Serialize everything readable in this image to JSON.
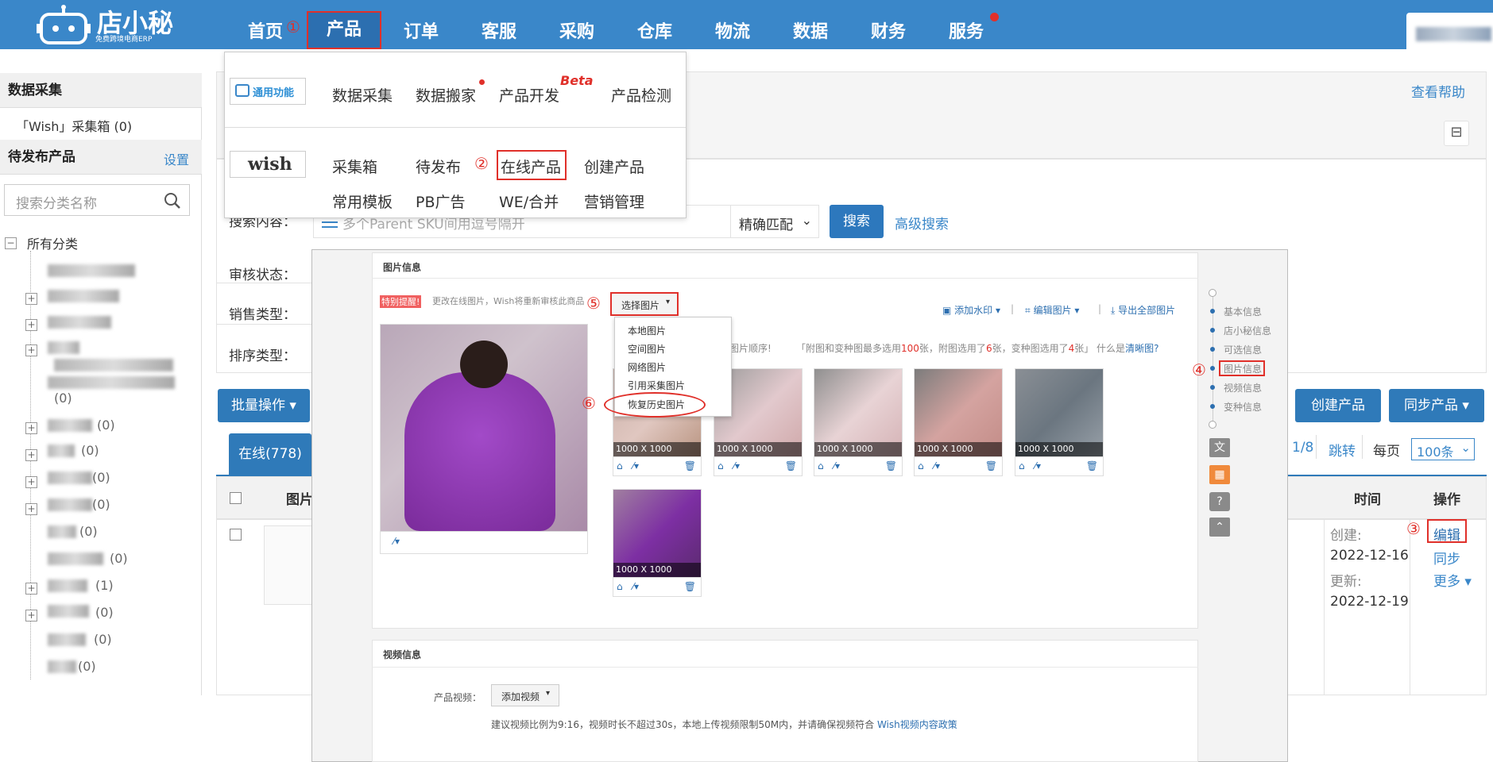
{
  "nav": {
    "logo_text": "店小秘",
    "logo_sub": "免费跨境电商ERP",
    "items": [
      "首页",
      "产品",
      "订单",
      "客服",
      "采购",
      "仓库",
      "物流",
      "数据",
      "财务",
      "服务"
    ],
    "steps": [
      "①",
      "②",
      "③",
      "④",
      "⑤",
      "⑥"
    ]
  },
  "sidebar": {
    "collect_title": "数据采集",
    "collect_box": "「Wish」采集箱 (0)",
    "pending_title": "待发布产品",
    "settings": "设置",
    "search_placeholder": "搜索分类名称",
    "all_categories": "所有分类",
    "counts": [
      "(0)",
      "(0)",
      "(0)",
      "(0)",
      "(0)",
      "(0)",
      "(0)",
      "(1)",
      "(0)",
      "(0)",
      "(0)"
    ]
  },
  "product_menu": {
    "general_tag": "通用功能",
    "wish_tag": "wish",
    "row1": [
      "数据采集",
      "数据搬家",
      "产品开发",
      "产品检测"
    ],
    "beta": "Beta",
    "row2": [
      "采集箱",
      "待发布",
      "在线产品",
      "创建产品"
    ],
    "row3": [
      "常用模板",
      "PB广告",
      "WE/合并",
      "营销管理"
    ]
  },
  "main": {
    "help": "查看帮助",
    "search_label": "搜索内容：",
    "search_placeholder": "多个Parent SKU间用逗号隔开",
    "match_select": "精确匹配",
    "search_btn": "搜索",
    "advanced_search": "高级搜索",
    "audit_status": "审核状态：",
    "sales_type": "销售类型：",
    "sort_type": "排序类型：",
    "bulk_ops": "批量操作",
    "create_product": "创建产品",
    "sync_product": "同步产品",
    "tab_online": "在线(778)",
    "pager": "1/8",
    "jump": "跳转",
    "per_page": "每页",
    "per_page_select": "100条",
    "col_image": "图片",
    "col_time": "时间",
    "col_ops": "操作",
    "created_label": "创建:",
    "created_date": "2022-12-16",
    "updated_label": "更新:",
    "updated_date": "2022-12-19",
    "op_edit": "编辑",
    "op_sync": "同步",
    "op_more": "更多"
  },
  "overlay": {
    "image_section": "图片信息",
    "notice_tag": "特别提醒!",
    "notice_text": "更改在线图片，Wish将重新审核此商品",
    "select_image": "选择图片",
    "add_watermark": "添加水印",
    "edit_image": "编辑图片",
    "export_all": "导出全部图片",
    "hint_text": "图片顺序!",
    "hint_text2": "「附图和变种图最多选用",
    "hint_100": "100",
    "hint_mid": "张，附图选用了",
    "hint_6": "6",
    "hint_mid2": "张，变种图选用了",
    "hint_4": "4",
    "hint_end": "张」 什么是",
    "hint_link": "清晰图?",
    "dropdown": [
      "本地图片",
      "空间图片",
      "网络图片",
      "引用采集图片",
      "恢复历史图片"
    ],
    "thumb_dims": [
      "1000 X 1000",
      "1000 X 1000",
      "1000 X 1000",
      "1000 X 1000",
      "1000 X 1000",
      "1000 X 1000"
    ],
    "right_nav": [
      "基本信息",
      "店小秘信息",
      "可选信息",
      "图片信息",
      "视频信息",
      "变种信息"
    ],
    "video_section": "视频信息",
    "video_label": "产品视频：",
    "add_video": "添加视频",
    "video_hint": "建议视频比例为9:16，视频时长不超过30s，本地上传视频限制50M内，并请确保视频符合",
    "video_policy": "Wish视频内容政策"
  },
  "colors": {
    "nav_blue": "#3a87c9",
    "highlight_red": "#e0302a",
    "button_blue": "#2d78bd"
  }
}
